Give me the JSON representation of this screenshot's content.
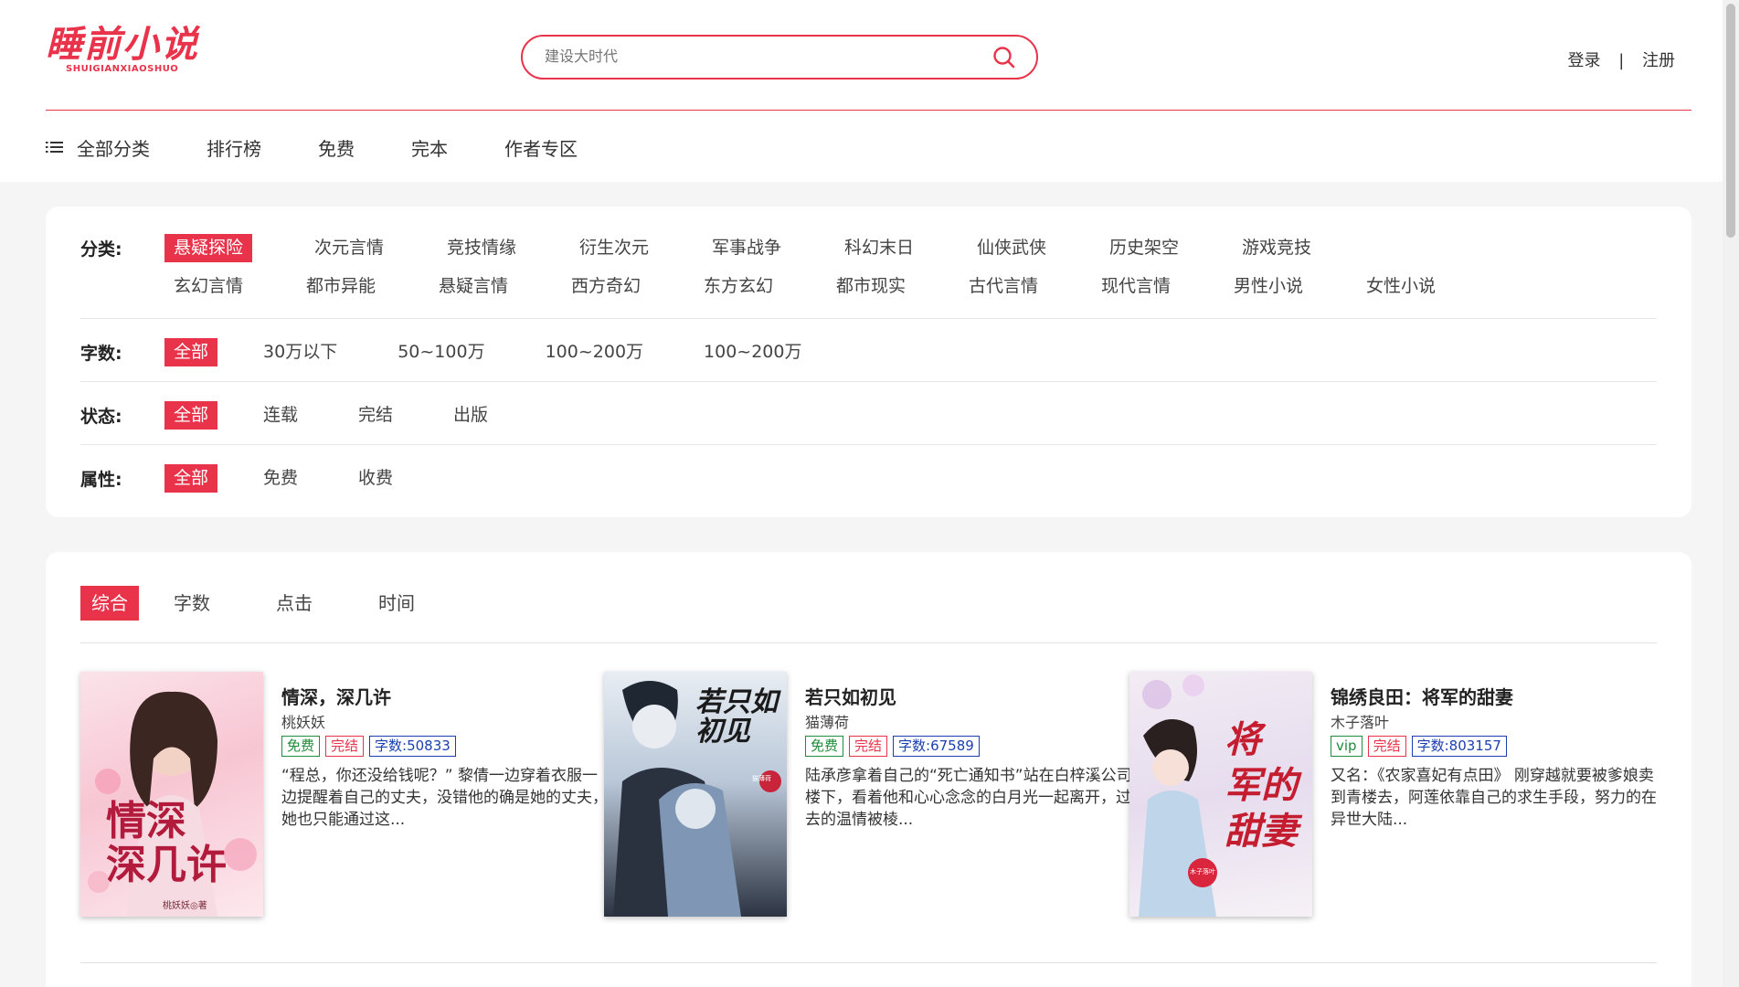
{
  "header": {
    "logo_cn": "睡前小说",
    "logo_en": "SHUIGIANXIAOSHUO",
    "search_placeholder": "建设大时代",
    "login": "登录",
    "separator": "|",
    "register": "注册"
  },
  "nav": {
    "all_categories": "全部分类",
    "items": [
      "排行榜",
      "免费",
      "完本",
      "作者专区"
    ]
  },
  "filters": {
    "category": {
      "label": "分类:",
      "options": [
        "悬疑探险",
        "次元言情",
        "竞技情缘",
        "衍生次元",
        "军事战争",
        "科幻末日",
        "仙侠武侠",
        "历史架空",
        "游戏竞技",
        "玄幻言情",
        "都市异能",
        "悬疑言情",
        "西方奇幻",
        "东方玄幻",
        "都市现实",
        "古代言情",
        "现代言情",
        "男性小说",
        "女性小说"
      ],
      "active": "悬疑探险"
    },
    "words": {
      "label": "字数:",
      "options": [
        "全部",
        "30万以下",
        "50~100万",
        "100~200万",
        "100~200万"
      ],
      "active": "全部"
    },
    "status": {
      "label": "状态:",
      "options": [
        "全部",
        "连载",
        "完结",
        "出版"
      ],
      "active": "全部"
    },
    "attribute": {
      "label": "属性:",
      "options": [
        "全部",
        "免费",
        "收费"
      ],
      "active": "全部"
    }
  },
  "sort": {
    "options": [
      "综合",
      "字数",
      "点击",
      "时间"
    ],
    "active": "综合"
  },
  "books": [
    {
      "title": "情深，深几许",
      "author": "桃妖妖",
      "tags": [
        {
          "text": "免费",
          "color": "green"
        },
        {
          "text": "完结",
          "color": "red"
        },
        {
          "text": "字数:50833",
          "color": "blue"
        }
      ],
      "desc": "“程总，你还没给钱呢？” 黎倩一边穿着衣服一边提醒着自己的丈夫，没错他的确是她的丈夫，她也只能通过这...",
      "cover_text": "情深\n深几许",
      "cover_author": "桃妖妖◎著"
    },
    {
      "title": "若只如初见",
      "author": "猫薄荷",
      "tags": [
        {
          "text": "免费",
          "color": "green"
        },
        {
          "text": "完结",
          "color": "red"
        },
        {
          "text": "字数:67589",
          "color": "blue"
        }
      ],
      "desc": "陆承彦拿着自己的“死亡通知书”站在白梓溪公司楼下，看着他和心心念念的白月光一起离开，过去的温情被棱...",
      "cover_text": "若只如\n初见",
      "cover_author": "猫薄荷"
    },
    {
      "title": "锦绣良田：将军的甜妻",
      "author": "木子落叶",
      "tags": [
        {
          "text": "vip",
          "color": "green"
        },
        {
          "text": "完结",
          "color": "red"
        },
        {
          "text": "字数:803157",
          "color": "blue"
        }
      ],
      "desc": "又名：《农家喜妃有点田》 刚穿越就要被爹娘卖到青楼去，阿莲依靠自己的求生手段，努力的在异世大陆...",
      "cover_text": "将\n军的\n甜妻",
      "cover_author": "木子落叶"
    }
  ],
  "colors": {
    "accent": "#e8334a",
    "tag_green": "#1e8c3a",
    "tag_blue": "#1c3fb0"
  }
}
